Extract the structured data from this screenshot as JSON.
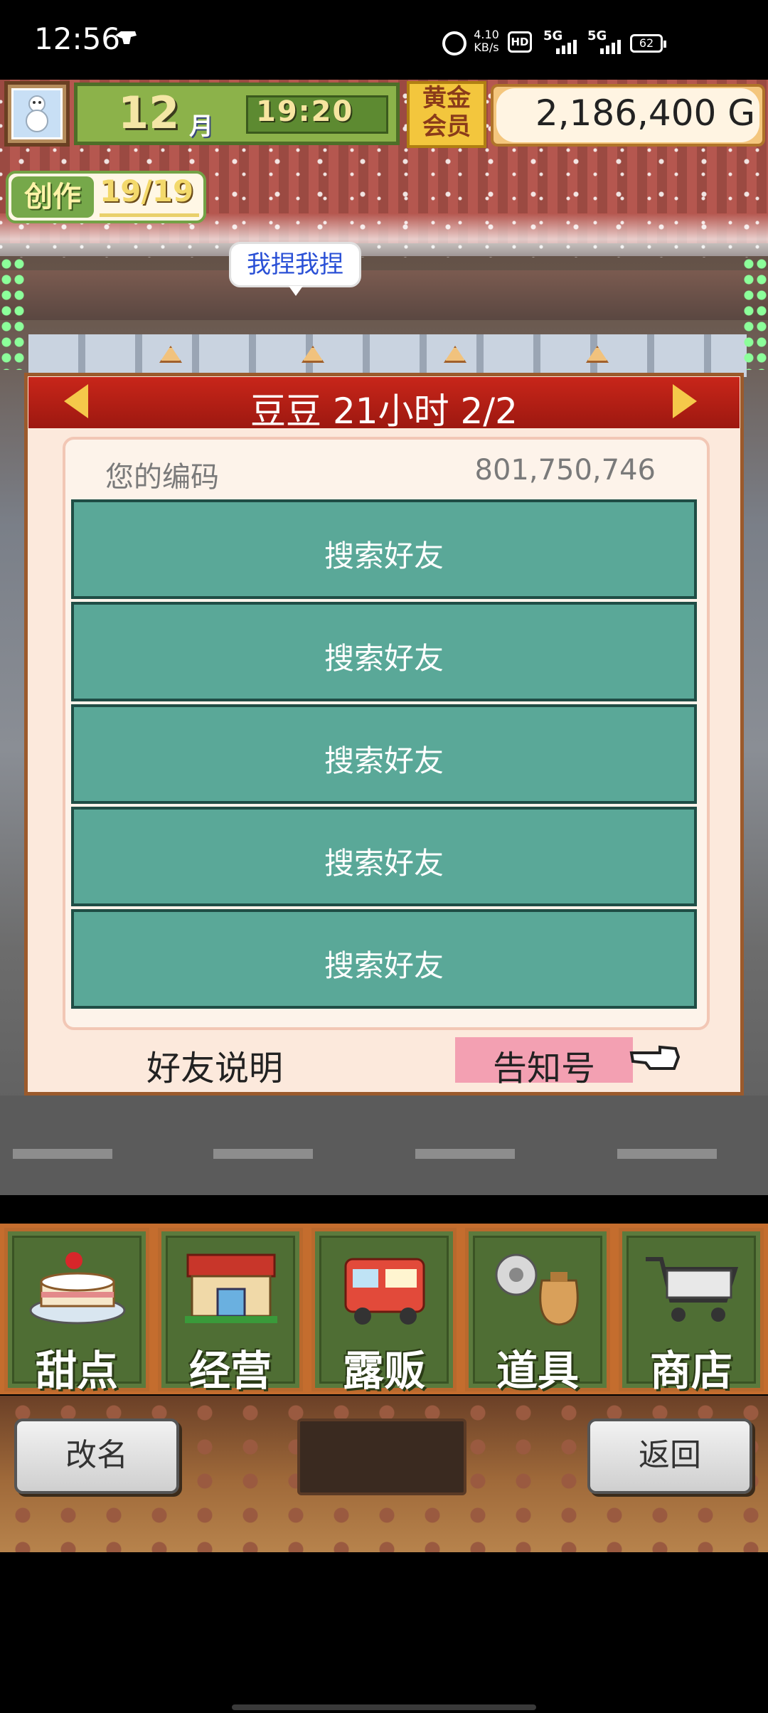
{
  "status_bar": {
    "time": "12:56",
    "speed_value": "4.10",
    "speed_unit": "KB/s",
    "hd_label": "HD",
    "sim1_label": "5G",
    "sim2_label": "5G",
    "battery": "62"
  },
  "hud": {
    "month": "12",
    "month_unit": "月",
    "clock": "19:20",
    "membership_badge": "黄金会员",
    "money": "2,186,400 G",
    "create_label": "创作",
    "create_count": "19/19",
    "speech_bubble": "我捏我捏"
  },
  "panel": {
    "title": "豆豆  21小时 2/2",
    "code_label": "您的编码",
    "code_value": "801,750,746",
    "friend_slots": [
      {
        "label": "搜索好友"
      },
      {
        "label": "搜索好友"
      },
      {
        "label": "搜索好友"
      },
      {
        "label": "搜索好友"
      },
      {
        "label": "搜索好友"
      }
    ],
    "help_label": "好友说明",
    "notice_label": "告知号"
  },
  "menu": {
    "items": [
      {
        "label": "甜点",
        "icon": "cake-icon"
      },
      {
        "label": "经营",
        "icon": "shop-icon"
      },
      {
        "label": "露贩",
        "icon": "food-truck-icon"
      },
      {
        "label": "道具",
        "icon": "item-bag-icon"
      },
      {
        "label": "商店",
        "icon": "shopping-cart-icon"
      }
    ]
  },
  "actions": {
    "rename_label": "改名",
    "back_label": "返回"
  },
  "colors": {
    "panel_header": "#c8261a",
    "friend_slot": "#5aa898",
    "notice_highlight": "#f3a0b2",
    "menu_green": "#5b7a3d"
  }
}
